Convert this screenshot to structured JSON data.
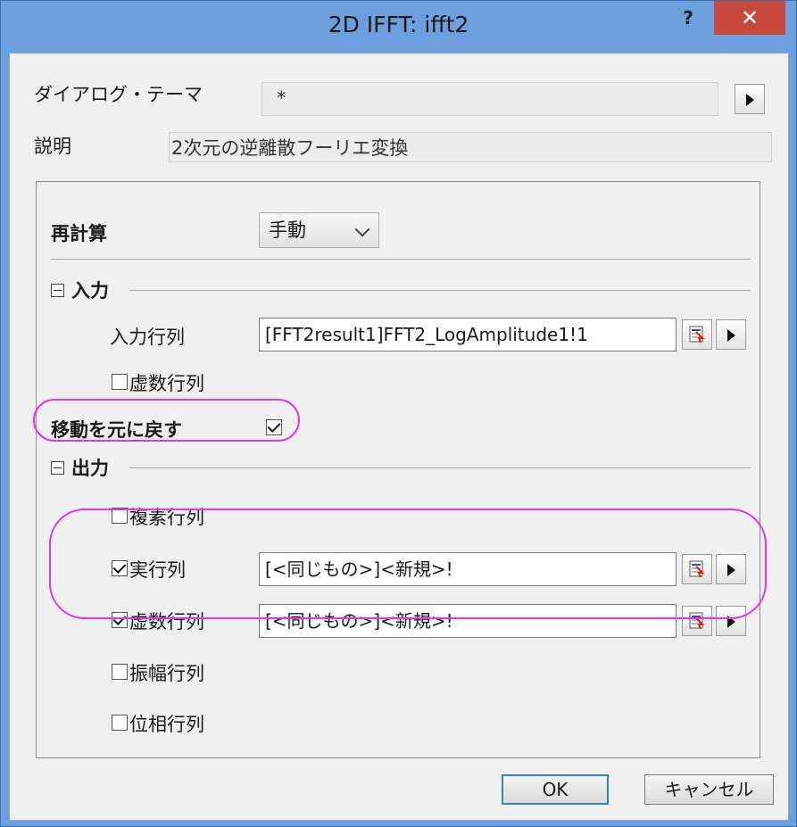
{
  "window": {
    "title": "2D IFFT: ifft2",
    "help_label": "?",
    "close_label": "✕"
  },
  "theme": {
    "label": "ダイアログ・テーマ",
    "value": "*"
  },
  "description": {
    "label": "説明",
    "value": "2次元の逆離散フーリエ変換"
  },
  "recalculate": {
    "label": "再計算",
    "value": "手動"
  },
  "input_section": {
    "title": "入力",
    "input_matrix_label": "入力行列",
    "input_matrix_value": "[FFT2result1]FFT2_LogAmplitude1!1",
    "imaginary_label": "虚数行列",
    "imaginary_checked": false
  },
  "undo_shift": {
    "label": "移動を元に戻す",
    "checked": true
  },
  "output_section": {
    "title": "出力",
    "complex_label": "複素行列",
    "complex_checked": false,
    "real_label": "実行列",
    "real_checked": true,
    "real_value": "[<同じもの>]<新規>!",
    "imag_label": "虚数行列",
    "imag_checked": true,
    "imag_value": "[<同じもの>]<新規>!",
    "amplitude_label": "振幅行列",
    "amplitude_checked": false,
    "phase_label": "位相行列",
    "phase_checked": false
  },
  "buttons": {
    "ok": "OK",
    "cancel": "キャンセル"
  },
  "colors": {
    "highlight": "#e535e5",
    "close_button": "#c7483d",
    "title_bar": "#6d9fde"
  }
}
